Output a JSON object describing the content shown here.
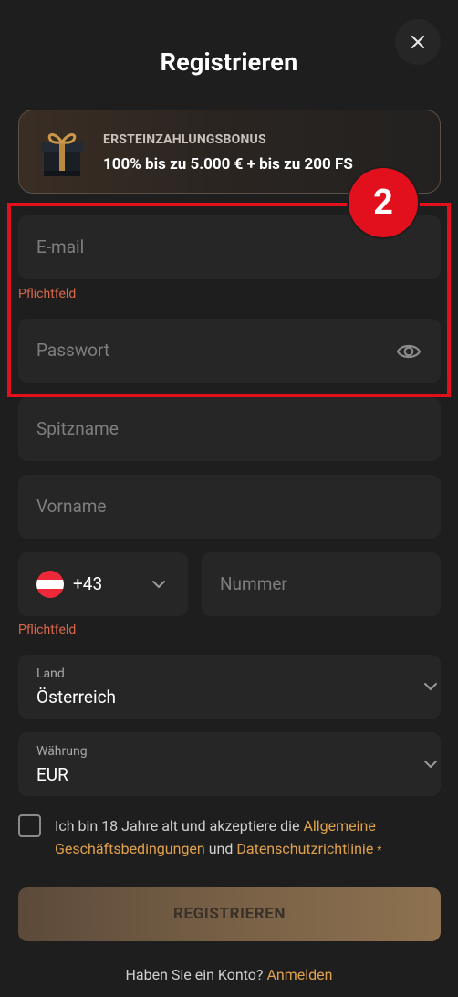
{
  "modal": {
    "title": "Registrieren",
    "close_icon": "close-icon"
  },
  "bonus": {
    "label": "ERSTEINZAHLUNGSBONUS",
    "text": "100% bis zu 5.000 € + bis zu 200 FS",
    "icon": "gift-icon"
  },
  "annotation": {
    "badge": "2",
    "color": "#e2101c"
  },
  "form": {
    "email_placeholder": "E-mail",
    "email_error": "Pflichtfeld",
    "password_placeholder": "Passwort",
    "password_icon": "eye-icon",
    "nickname_placeholder": "Spitzname",
    "firstname_placeholder": "Vorname",
    "phone": {
      "country_code": "+43",
      "flag": "austria-flag-icon",
      "number_placeholder": "Nummer",
      "error": "Pflichtfeld"
    },
    "country": {
      "label": "Land",
      "value": "Österreich"
    },
    "currency": {
      "label": "Währung",
      "value": "EUR"
    },
    "terms": {
      "prefix": "Ich bin 18 Jahre alt und akzeptiere die ",
      "link1": "Allgemeine Geschäftsbedingungen",
      "middle": " und ",
      "link2": "Datenschutzrichtlinie",
      "required_mark": "*"
    },
    "submit_label": "REGISTRIEREN"
  },
  "footer": {
    "text": "Haben Sie ein Konto? ",
    "link": "Anmelden"
  },
  "colors": {
    "background": "#1e1e1e",
    "field": "#262626",
    "accent": "#e0a14d",
    "error": "#d9674a"
  }
}
